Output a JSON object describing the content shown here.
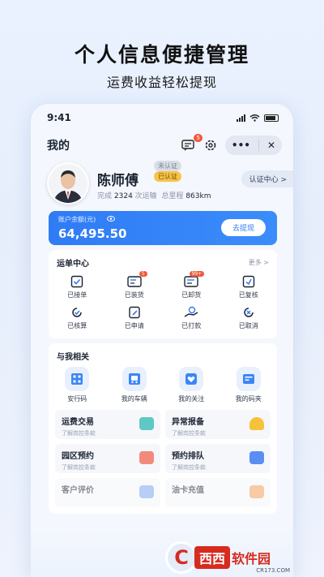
{
  "promo": {
    "title": "个人信息便捷管理",
    "subtitle": "运费收益轻松提现"
  },
  "status": {
    "time": "9:41"
  },
  "topbar": {
    "title": "我的",
    "message_badge": "5",
    "more_glyph": "•••",
    "close_glyph": "✕"
  },
  "profile": {
    "name": "陈师傅",
    "badge_unverified": "未认证",
    "badge_verified": "已认证",
    "stats_done_label": "完成",
    "stats_done_value": "2324",
    "stats_done_unit": "次运输",
    "stats_mileage_label": "总里程",
    "stats_mileage_value": "863km",
    "cert_button": "认证中心 >"
  },
  "balance": {
    "label": "账户余额(元)",
    "value": "64,495.50",
    "withdraw": "去提现"
  },
  "orders": {
    "title": "运单中心",
    "more": "更多 >",
    "items": [
      {
        "label": "已接单",
        "badge": ""
      },
      {
        "label": "已装货",
        "badge": "5"
      },
      {
        "label": "已卸货",
        "badge": "99+"
      },
      {
        "label": "已复核",
        "badge": ""
      },
      {
        "label": "已核算",
        "badge": ""
      },
      {
        "label": "已申请",
        "badge": ""
      },
      {
        "label": "已打款",
        "badge": ""
      },
      {
        "label": "已取消",
        "badge": ""
      }
    ]
  },
  "related": {
    "title": "与我相关",
    "items": [
      {
        "label": "安行码"
      },
      {
        "label": "我的车辆"
      },
      {
        "label": "我的关注"
      },
      {
        "label": "我的码夹"
      }
    ],
    "services": [
      {
        "title": "运费交易",
        "desc": "了解岗控条款",
        "color": "#5fc8c4"
      },
      {
        "title": "异常报备",
        "desc": "了解岗控条款",
        "color": "#f5c23a"
      },
      {
        "title": "园区预约",
        "desc": "了解岗控条款",
        "color": "#f28a7c"
      },
      {
        "title": "预约排队",
        "desc": "了解岗控条款",
        "color": "#5a8ef2"
      },
      {
        "title": "客户评价",
        "desc": "",
        "color": "#7fa7f2"
      },
      {
        "title": "油卡充值",
        "desc": "",
        "color": "#f2a25a"
      }
    ]
  },
  "watermark": {
    "brand_a": "西西",
    "brand_b": "软件园",
    "sub": "CR173.COM"
  },
  "colors": {
    "accent": "#2f7bf5",
    "badge": "#f1573b",
    "verified": "#f6c449"
  }
}
